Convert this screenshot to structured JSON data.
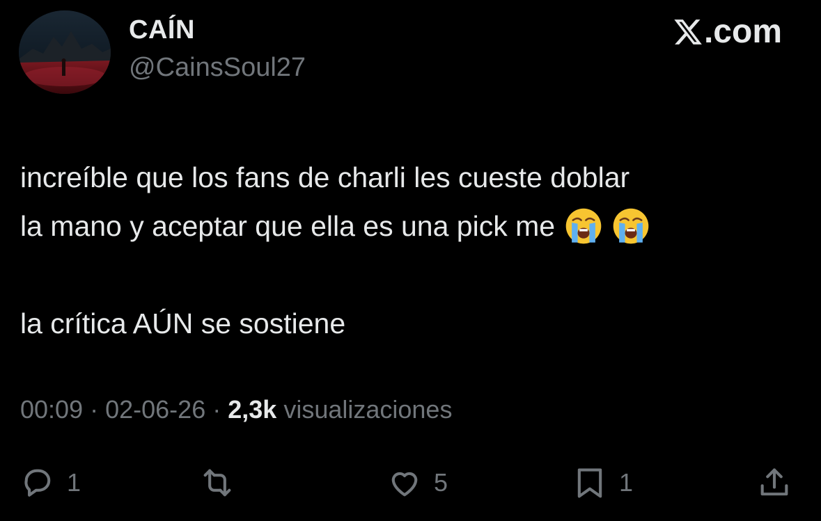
{
  "author": {
    "display_name": "CAÍN",
    "handle": "@CainsSoul27",
    "avatar_icon": "avatar-dark-landscape"
  },
  "brand": {
    "label": ".com",
    "icon": "x-logo-icon"
  },
  "tweet": {
    "lines": [
      "increíble que los fans de charli les cueste doblar",
      "la mano y aceptar que ella es una pick me",
      "la crítica AÚN se sostiene"
    ],
    "emojis": [
      "loudly-crying-face",
      "loudly-crying-face"
    ]
  },
  "meta": {
    "time": "00:09",
    "date": "02-06-26",
    "separator": "·",
    "views_count": "2,3k",
    "views_label": "visualizaciones"
  },
  "actions": {
    "reply_count": "1",
    "repost_count": "",
    "like_count": "5",
    "bookmark_count": "1"
  },
  "colors": {
    "background": "#000000",
    "primary_text": "#e7e9ea",
    "secondary_text": "#71767b"
  }
}
